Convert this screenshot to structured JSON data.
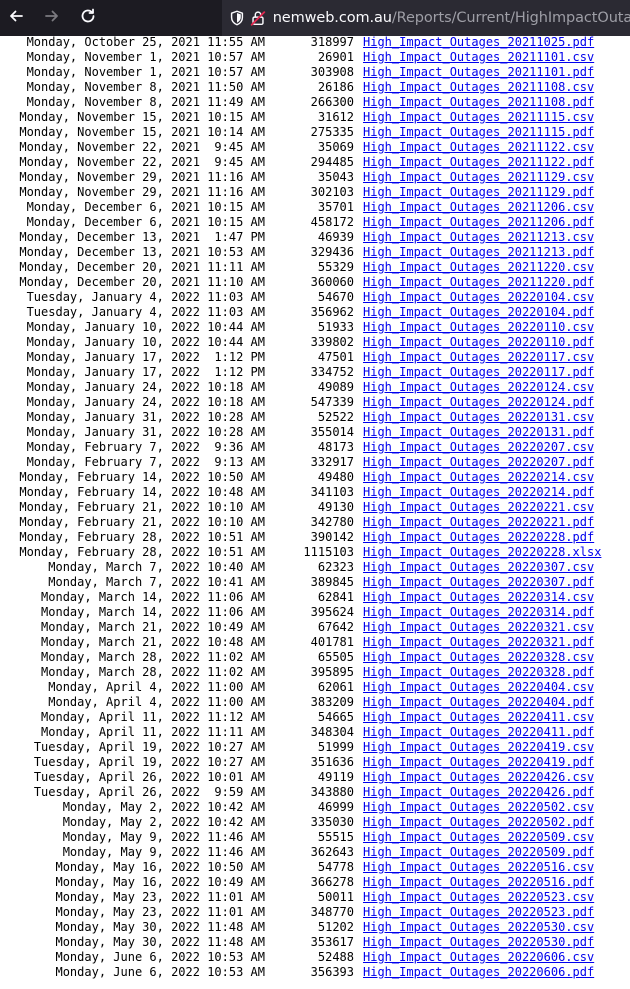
{
  "browser": {
    "url_host": "nemweb.com.au",
    "url_path": "/Reports/Current/HighImpactOutages/",
    "icons": [
      "back-arrow-icon",
      "forward-arrow-icon",
      "reload-icon",
      "shield-icon",
      "insecure-lock-icon"
    ]
  },
  "listing": {
    "rows": [
      {
        "date": "Monday, October 25, 2021 11:55 AM",
        "size": "318997",
        "file": "High_Impact_Outages_20211025.pdf"
      },
      {
        "date": "Monday, November 1, 2021 10:57 AM",
        "size": "26901",
        "file": "High_Impact_Outages_20211101.csv"
      },
      {
        "date": "Monday, November 1, 2021 10:57 AM",
        "size": "303908",
        "file": "High_Impact_Outages_20211101.pdf"
      },
      {
        "date": "Monday, November 8, 2021 11:50 AM",
        "size": "26186",
        "file": "High_Impact_Outages_20211108.csv"
      },
      {
        "date": "Monday, November 8, 2021 11:49 AM",
        "size": "266300",
        "file": "High_Impact_Outages_20211108.pdf"
      },
      {
        "date": "Monday, November 15, 2021 10:15 AM",
        "size": "31612",
        "file": "High_Impact_Outages_20211115.csv"
      },
      {
        "date": "Monday, November 15, 2021 10:14 AM",
        "size": "275335",
        "file": "High_Impact_Outages_20211115.pdf"
      },
      {
        "date": "Monday, November 22, 2021  9:45 AM",
        "size": "35069",
        "file": "High_Impact_Outages_20211122.csv"
      },
      {
        "date": "Monday, November 22, 2021  9:45 AM",
        "size": "294485",
        "file": "High_Impact_Outages_20211122.pdf"
      },
      {
        "date": "Monday, November 29, 2021 11:16 AM",
        "size": "35043",
        "file": "High_Impact_Outages_20211129.csv"
      },
      {
        "date": "Monday, November 29, 2021 11:16 AM",
        "size": "302103",
        "file": "High_Impact_Outages_20211129.pdf"
      },
      {
        "date": "Monday, December 6, 2021 10:15 AM",
        "size": "35701",
        "file": "High_Impact_Outages_20211206.csv"
      },
      {
        "date": "Monday, December 6, 2021 10:15 AM",
        "size": "458172",
        "file": "High_Impact_Outages_20211206.pdf"
      },
      {
        "date": "Monday, December 13, 2021  1:47 PM",
        "size": "46939",
        "file": "High_Impact_Outages_20211213.csv"
      },
      {
        "date": "Monday, December 13, 2021 10:53 AM",
        "size": "329436",
        "file": "High_Impact_Outages_20211213.pdf"
      },
      {
        "date": "Monday, December 20, 2021 11:11 AM",
        "size": "55329",
        "file": "High_Impact_Outages_20211220.csv"
      },
      {
        "date": "Monday, December 20, 2021 11:10 AM",
        "size": "360060",
        "file": "High_Impact_Outages_20211220.pdf"
      },
      {
        "date": "Tuesday, January 4, 2022 11:03 AM",
        "size": "54670",
        "file": "High_Impact_Outages_20220104.csv"
      },
      {
        "date": "Tuesday, January 4, 2022 11:03 AM",
        "size": "356962",
        "file": "High_Impact_Outages_20220104.pdf"
      },
      {
        "date": "Monday, January 10, 2022 10:44 AM",
        "size": "51933",
        "file": "High_Impact_Outages_20220110.csv"
      },
      {
        "date": "Monday, January 10, 2022 10:44 AM",
        "size": "339802",
        "file": "High_Impact_Outages_20220110.pdf"
      },
      {
        "date": "Monday, January 17, 2022  1:12 PM",
        "size": "47501",
        "file": "High_Impact_Outages_20220117.csv"
      },
      {
        "date": "Monday, January 17, 2022  1:12 PM",
        "size": "334752",
        "file": "High_Impact_Outages_20220117.pdf"
      },
      {
        "date": "Monday, January 24, 2022 10:18 AM",
        "size": "49089",
        "file": "High_Impact_Outages_20220124.csv"
      },
      {
        "date": "Monday, January 24, 2022 10:18 AM",
        "size": "547339",
        "file": "High_Impact_Outages_20220124.pdf"
      },
      {
        "date": "Monday, January 31, 2022 10:28 AM",
        "size": "52522",
        "file": "High_Impact_Outages_20220131.csv"
      },
      {
        "date": "Monday, January 31, 2022 10:28 AM",
        "size": "355014",
        "file": "High_Impact_Outages_20220131.pdf"
      },
      {
        "date": "Monday, February 7, 2022  9:36 AM",
        "size": "48173",
        "file": "High_Impact_Outages_20220207.csv"
      },
      {
        "date": "Monday, February 7, 2022  9:13 AM",
        "size": "332917",
        "file": "High_Impact_Outages_20220207.pdf"
      },
      {
        "date": "Monday, February 14, 2022 10:50 AM",
        "size": "49480",
        "file": "High_Impact_Outages_20220214.csv"
      },
      {
        "date": "Monday, February 14, 2022 10:48 AM",
        "size": "341103",
        "file": "High_Impact_Outages_20220214.pdf"
      },
      {
        "date": "Monday, February 21, 2022 10:10 AM",
        "size": "49130",
        "file": "High_Impact_Outages_20220221.csv"
      },
      {
        "date": "Monday, February 21, 2022 10:10 AM",
        "size": "342780",
        "file": "High_Impact_Outages_20220221.pdf"
      },
      {
        "date": "Monday, February 28, 2022 10:51 AM",
        "size": "390142",
        "file": "High_Impact_Outages_20220228.pdf"
      },
      {
        "date": "Monday, February 28, 2022 10:51 AM",
        "size": "1115103",
        "file": "High_Impact_Outages_20220228.xlsx"
      },
      {
        "date": "Monday, March 7, 2022 10:40 AM",
        "size": "62323",
        "file": "High_Impact_Outages_20220307.csv"
      },
      {
        "date": "Monday, March 7, 2022 10:41 AM",
        "size": "389845",
        "file": "High_Impact_Outages_20220307.pdf"
      },
      {
        "date": "Monday, March 14, 2022 11:06 AM",
        "size": "62841",
        "file": "High_Impact_Outages_20220314.csv"
      },
      {
        "date": "Monday, March 14, 2022 11:06 AM",
        "size": "395624",
        "file": "High_Impact_Outages_20220314.pdf"
      },
      {
        "date": "Monday, March 21, 2022 10:49 AM",
        "size": "67642",
        "file": "High_Impact_Outages_20220321.csv"
      },
      {
        "date": "Monday, March 21, 2022 10:48 AM",
        "size": "401781",
        "file": "High_Impact_Outages_20220321.pdf"
      },
      {
        "date": "Monday, March 28, 2022 11:02 AM",
        "size": "65505",
        "file": "High_Impact_Outages_20220328.csv"
      },
      {
        "date": "Monday, March 28, 2022 11:02 AM",
        "size": "395895",
        "file": "High_Impact_Outages_20220328.pdf"
      },
      {
        "date": "Monday, April 4, 2022 11:00 AM",
        "size": "62061",
        "file": "High_Impact_Outages_20220404.csv"
      },
      {
        "date": "Monday, April 4, 2022 11:00 AM",
        "size": "383209",
        "file": "High_Impact_Outages_20220404.pdf"
      },
      {
        "date": "Monday, April 11, 2022 11:12 AM",
        "size": "54665",
        "file": "High_Impact_Outages_20220411.csv"
      },
      {
        "date": "Monday, April 11, 2022 11:11 AM",
        "size": "348304",
        "file": "High_Impact_Outages_20220411.pdf"
      },
      {
        "date": "Tuesday, April 19, 2022 10:27 AM",
        "size": "51999",
        "file": "High_Impact_Outages_20220419.csv"
      },
      {
        "date": "Tuesday, April 19, 2022 10:27 AM",
        "size": "351636",
        "file": "High_Impact_Outages_20220419.pdf"
      },
      {
        "date": "Tuesday, April 26, 2022 10:01 AM",
        "size": "49119",
        "file": "High_Impact_Outages_20220426.csv"
      },
      {
        "date": "Tuesday, April 26, 2022  9:59 AM",
        "size": "343880",
        "file": "High_Impact_Outages_20220426.pdf"
      },
      {
        "date": "Monday, May 2, 2022 10:42 AM",
        "size": "46999",
        "file": "High_Impact_Outages_20220502.csv"
      },
      {
        "date": "Monday, May 2, 2022 10:42 AM",
        "size": "335030",
        "file": "High_Impact_Outages_20220502.pdf"
      },
      {
        "date": "Monday, May 9, 2022 11:46 AM",
        "size": "55515",
        "file": "High_Impact_Outages_20220509.csv"
      },
      {
        "date": "Monday, May 9, 2022 11:46 AM",
        "size": "362643",
        "file": "High_Impact_Outages_20220509.pdf"
      },
      {
        "date": "Monday, May 16, 2022 10:50 AM",
        "size": "54778",
        "file": "High_Impact_Outages_20220516.csv"
      },
      {
        "date": "Monday, May 16, 2022 10:49 AM",
        "size": "366278",
        "file": "High_Impact_Outages_20220516.pdf"
      },
      {
        "date": "Monday, May 23, 2022 11:01 AM",
        "size": "50011",
        "file": "High_Impact_Outages_20220523.csv"
      },
      {
        "date": "Monday, May 23, 2022 11:01 AM",
        "size": "348770",
        "file": "High_Impact_Outages_20220523.pdf"
      },
      {
        "date": "Monday, May 30, 2022 11:48 AM",
        "size": "51202",
        "file": "High_Impact_Outages_20220530.csv"
      },
      {
        "date": "Monday, May 30, 2022 11:48 AM",
        "size": "353617",
        "file": "High_Impact_Outages_20220530.pdf"
      },
      {
        "date": "Monday, June 6, 2022 10:53 AM",
        "size": "52488",
        "file": "High_Impact_Outages_20220606.csv"
      },
      {
        "date": "Monday, June 6, 2022 10:53 AM",
        "size": "356393",
        "file": "High_Impact_Outages_20220606.pdf"
      }
    ]
  }
}
